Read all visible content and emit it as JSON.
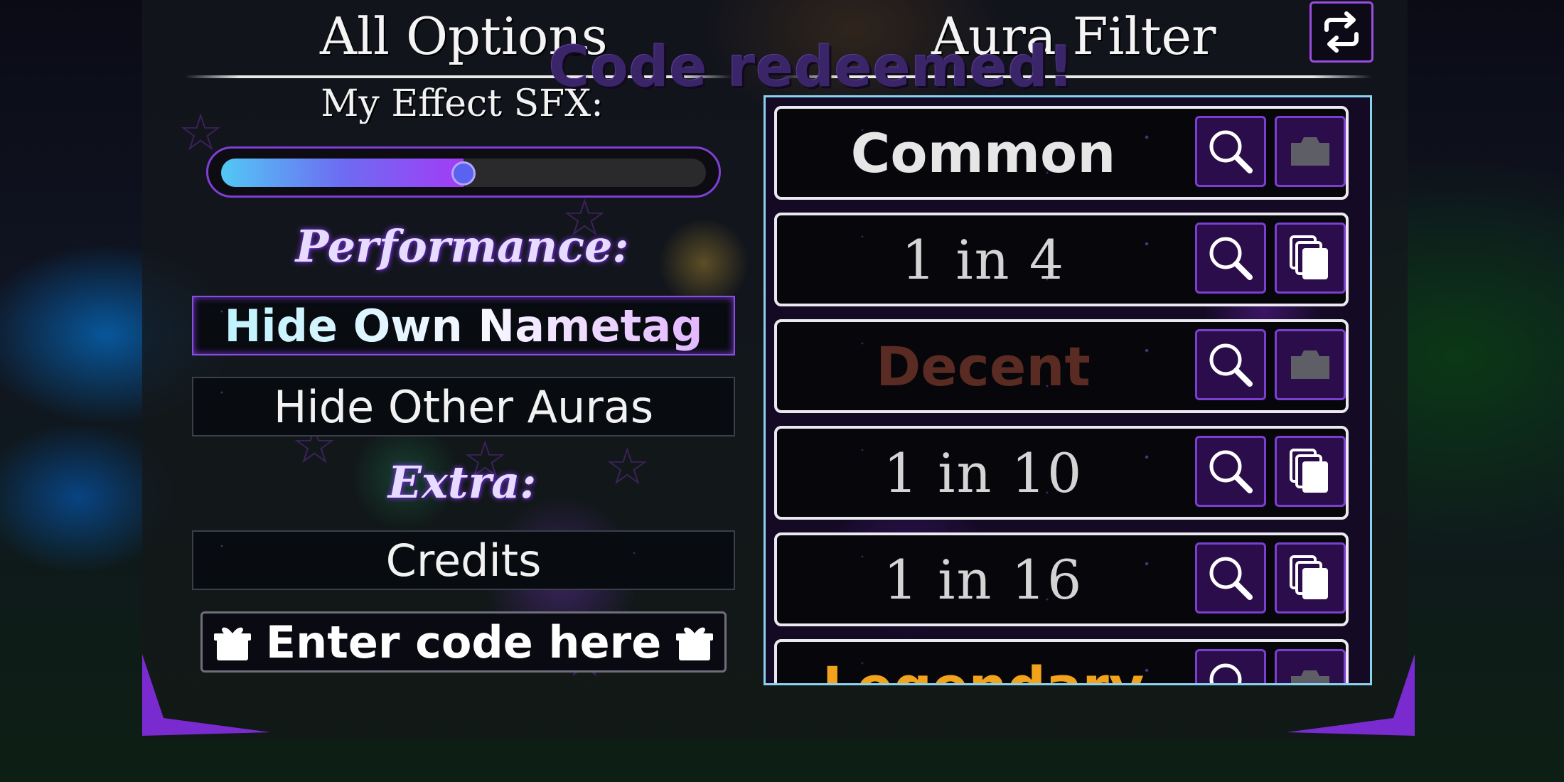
{
  "header": {
    "left_title": "All Options",
    "right_title": "Aura Filter"
  },
  "toast": "Code redeemed!",
  "settings": {
    "sfx_label": "My Effect SFX:",
    "sfx_volume": 0.5,
    "performance_title": "Performance:",
    "hide_nametag": "Hide Own Nametag",
    "hide_auras": "Hide Other Auras",
    "extra_title": "Extra:",
    "credits": "Credits",
    "code_placeholder": "Enter code here"
  },
  "auras": [
    {
      "name": "Common",
      "color": "#e6e6e6",
      "style": "sans",
      "copy_icon": "camera-icon"
    },
    {
      "name": "1 in 4",
      "color": "#d4d4d4",
      "style": "serif",
      "copy_icon": "copy-icon"
    },
    {
      "name": "Decent",
      "color": "#5a2b22",
      "style": "sans",
      "copy_icon": "camera-icon"
    },
    {
      "name": "1 in 10",
      "color": "#d4d4d4",
      "style": "serif",
      "copy_icon": "copy-icon"
    },
    {
      "name": "1 in 16",
      "color": "#d4d4d4",
      "style": "serif",
      "copy_icon": "copy-icon"
    },
    {
      "name": "Legendary",
      "color": "#f2a21b",
      "style": "sans",
      "copy_icon": "camera-icon"
    }
  ],
  "colors": {
    "accent": "#8b4fe0",
    "frame": "#8bd1f0",
    "slider_start": "#52c8f4",
    "slider_end": "#a33cf5"
  }
}
